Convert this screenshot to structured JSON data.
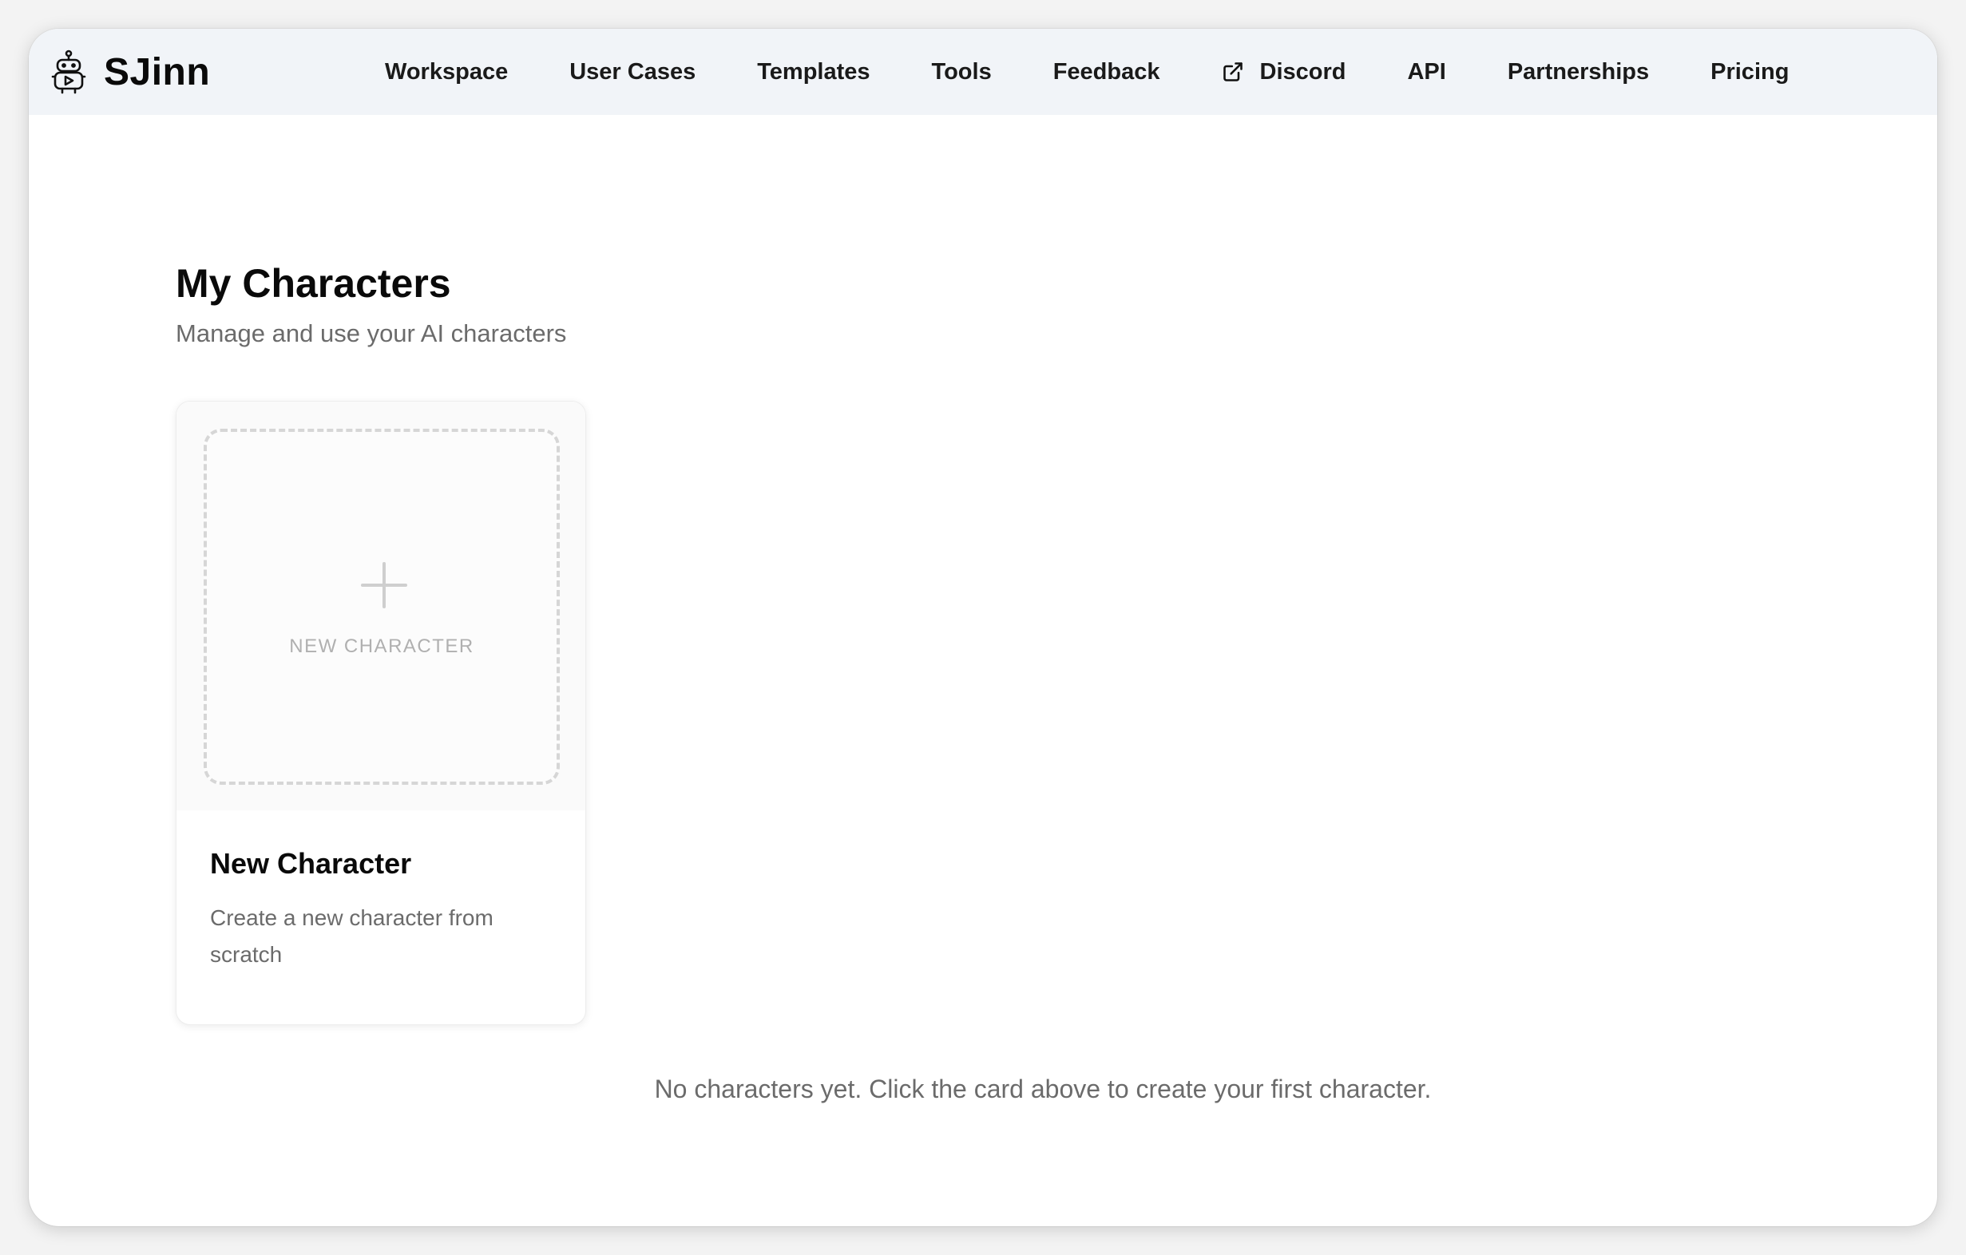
{
  "nav": {
    "brand": "SJinn",
    "links": [
      {
        "label": "Workspace"
      },
      {
        "label": "User Cases"
      },
      {
        "label": "Templates"
      },
      {
        "label": "Tools"
      },
      {
        "label": "Feedback"
      },
      {
        "label": "Discord",
        "icon": "external-link-icon"
      },
      {
        "label": "API"
      },
      {
        "label": "Partnerships"
      },
      {
        "label": "Pricing"
      }
    ]
  },
  "header": {
    "title": "My Characters",
    "subtitle": "Manage and use your AI characters"
  },
  "new_card": {
    "placeholder_label": "NEW CHARACTER",
    "title": "New Character",
    "description": "Create a new character from scratch"
  },
  "empty_state": {
    "message": "No characters yet. Click the card above to create your first character."
  },
  "colors": {
    "navbar_bg": "#f1f4f8",
    "text_primary": "#0a0a0a",
    "text_secondary": "#6b6b6b",
    "placeholder_border": "#d6d6d6"
  }
}
